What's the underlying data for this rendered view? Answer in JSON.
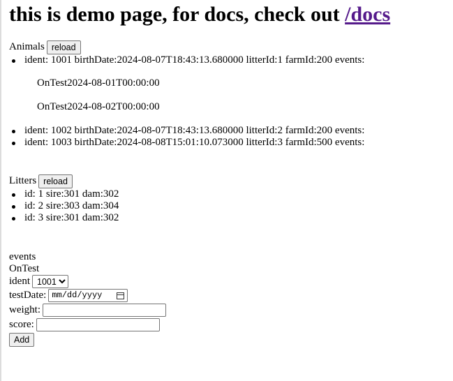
{
  "header": {
    "title_text": "this is demo page, for docs, check out ",
    "docs_link": "/docs"
  },
  "animals": {
    "label": "Animals",
    "reload_label": "reload",
    "items": [
      {
        "text": "ident: 1001 birthDate:2024-08-07T18:43:13.680000 litterId:1 farmId:200 events:",
        "events": [
          "OnTest2024-08-01T00:00:00",
          "OnTest2024-08-02T00:00:00"
        ]
      },
      {
        "text": "ident: 1002 birthDate:2024-08-07T18:43:13.680000 litterId:2 farmId:200 events:"
      },
      {
        "text": "ident: 1003 birthDate:2024-08-08T15:01:10.073000 litterId:3 farmId:500 events:"
      }
    ]
  },
  "litters": {
    "label": "Litters",
    "reload_label": "reload",
    "items": [
      "id: 1 sire:301 dam:302",
      "id: 2 sire:303 dam:304",
      "id: 3 sire:301 dam:302"
    ]
  },
  "events_form": {
    "heading": "events",
    "event_type": "OnTest",
    "ident_label": "ident",
    "ident_selected": "1001",
    "test_date_label": "testDate:",
    "test_date_placeholder": "mm/dd/yyyy",
    "weight_label": "weight:",
    "weight_value": "",
    "score_label": "score:",
    "score_value": "",
    "add_label": "Add"
  }
}
